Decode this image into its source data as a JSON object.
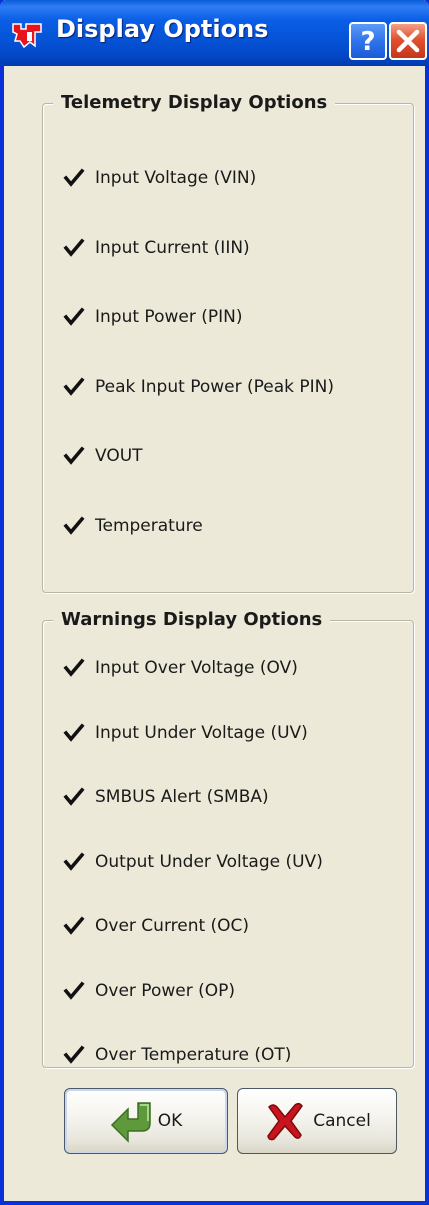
{
  "window": {
    "title": "Display Options"
  },
  "titlebar_buttons": {
    "help_glyph": "?",
    "close_glyph": "✕"
  },
  "telemetry": {
    "legend": "Telemetry Display Options",
    "items": [
      {
        "label": "Input Voltage (VIN)",
        "checked": true
      },
      {
        "label": "Input Current (IIN)",
        "checked": true
      },
      {
        "label": "Input Power (PIN)",
        "checked": true
      },
      {
        "label": "Peak Input Power (Peak PIN)",
        "checked": true
      },
      {
        "label": "VOUT",
        "checked": true
      },
      {
        "label": "Temperature",
        "checked": true
      }
    ]
  },
  "warnings": {
    "legend": "Warnings Display Options",
    "items": [
      {
        "label": "Input Over Voltage (OV)",
        "checked": true
      },
      {
        "label": "Input Under Voltage (UV)",
        "checked": true
      },
      {
        "label": "SMBUS Alert (SMBA)",
        "checked": true
      },
      {
        "label": "Output Under Voltage (UV)",
        "checked": true
      },
      {
        "label": "Over Current (OC)",
        "checked": true
      },
      {
        "label": "Over Power (OP)",
        "checked": true
      },
      {
        "label": "Over Temperature (OT)",
        "checked": true
      }
    ]
  },
  "buttons": {
    "ok_label": "OK",
    "cancel_label": "Cancel"
  },
  "colors": {
    "titlebar": "#0553d6",
    "window_bg": "#ece9d8",
    "close_button": "#e0522f",
    "logo_red": "#e8141c",
    "ok_arrow_green": "#5e9a3c",
    "cancel_x_red": "#c8141c"
  },
  "icons": {
    "app": "ti-logo-icon",
    "help": "help-icon",
    "close": "close-icon",
    "ok": "green-arrow-icon",
    "cancel": "red-x-icon",
    "checkbox": "checkmark-icon"
  }
}
